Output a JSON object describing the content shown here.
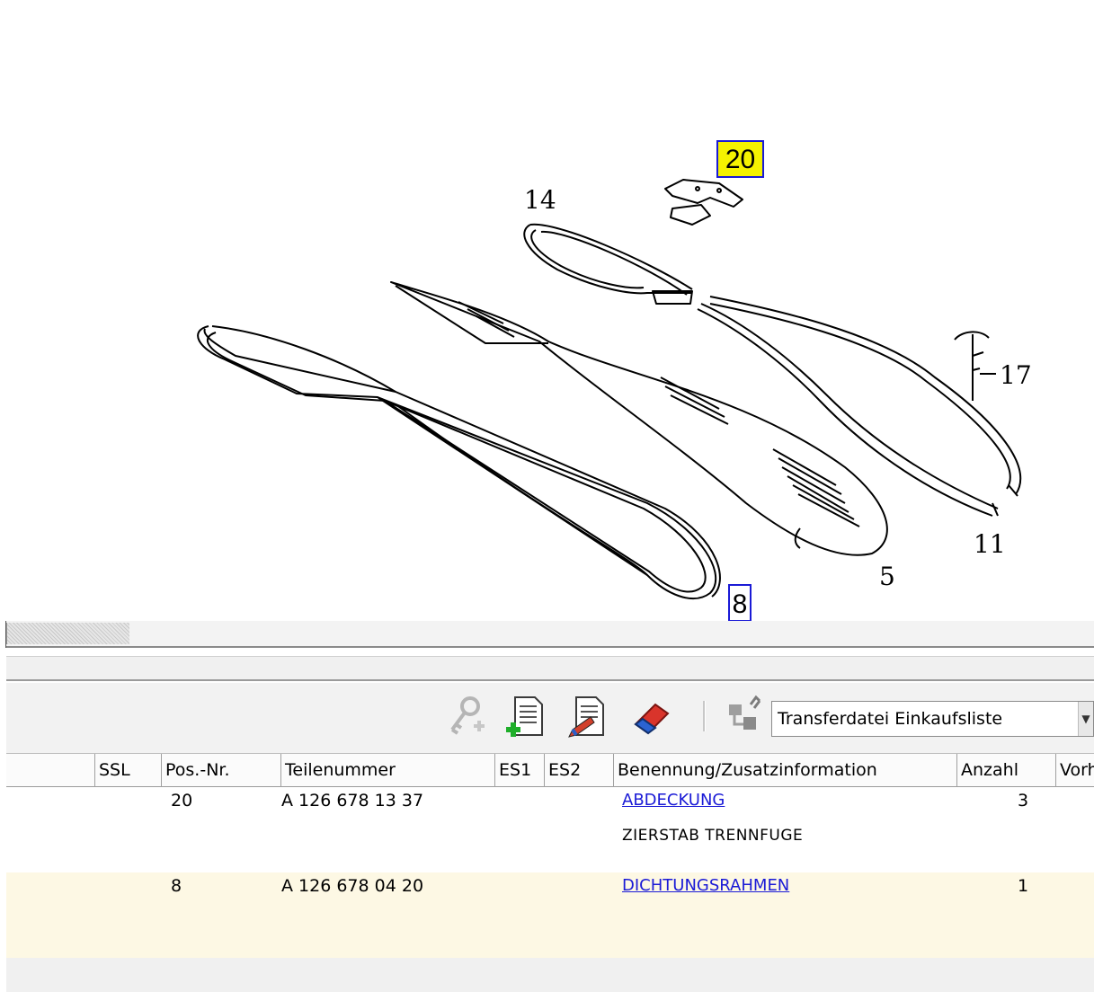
{
  "diagram": {
    "callouts": [
      "14",
      "17",
      "11",
      "5"
    ],
    "hotspots": [
      "20",
      "8"
    ]
  },
  "toolbar": {
    "buttons": [
      "key-search-icon",
      "add-document-icon",
      "edit-document-icon",
      "eraser-icon",
      "transfer-icon"
    ],
    "transfer_select": "Transferdatei Einkaufsliste"
  },
  "table": {
    "columns": [
      "SSL",
      "Pos.-Nr.",
      "Teilenummer",
      "ES1",
      "ES2",
      "Benennung/Zusatzinformation",
      "Anzahl",
      "Vorh"
    ],
    "rows": [
      {
        "ssl": "",
        "pos": "20",
        "part_number": "A 126 678 13 37",
        "es1": "",
        "es2": "",
        "name": "ABDECKUNG",
        "info": "ZIERSTAB TRENNFUGE",
        "qty": "3"
      },
      {
        "ssl": "",
        "pos": "8",
        "part_number": "A 126 678 04 20",
        "es1": "",
        "es2": "",
        "name": "DICHTUNGSRAHMEN",
        "info": "",
        "qty": "1"
      }
    ]
  },
  "colors": {
    "hotspot_border": "#1a1ad6",
    "hotspot_selected": "#f5f200",
    "link": "#1a1ad6",
    "selected_row": "#fdf8e4"
  }
}
